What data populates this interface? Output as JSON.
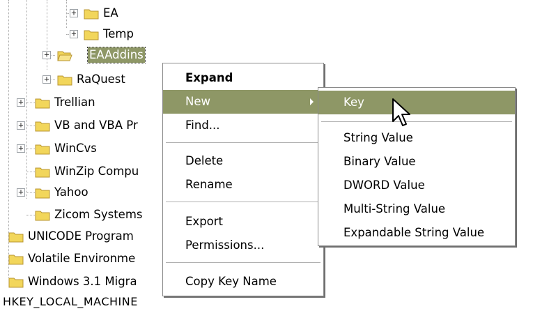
{
  "tree": {
    "items": [
      {
        "label": "EA",
        "expander": "+",
        "icon": "folder-icon"
      },
      {
        "label": "Temp",
        "expander": "+",
        "icon": "folder-icon"
      },
      {
        "label": "EAAddins",
        "expander": "+",
        "icon": "folder-open-icon",
        "selected": true
      },
      {
        "label": "RaQuest",
        "expander": "+",
        "icon": "folder-icon"
      },
      {
        "label": "Trellian",
        "expander": "+",
        "icon": "folder-icon"
      },
      {
        "label": "VB and VBA Pr",
        "expander": "+",
        "icon": "folder-icon"
      },
      {
        "label": "WinCvs",
        "expander": "+",
        "icon": "folder-icon"
      },
      {
        "label": "WinZip Compu",
        "expander": "",
        "icon": "folder-icon"
      },
      {
        "label": "Yahoo",
        "expander": "+",
        "icon": "folder-icon"
      },
      {
        "label": "Zicom Systems",
        "expander": "",
        "icon": "folder-icon"
      },
      {
        "label": "UNICODE Program",
        "expander": "",
        "icon": "folder-icon"
      },
      {
        "label": "Volatile Environme",
        "expander": "",
        "icon": "folder-icon"
      },
      {
        "label": "Windows 3.1 Migra",
        "expander": "",
        "icon": "folder-icon"
      }
    ],
    "root_label": "HKEY_LOCAL_MACHINE"
  },
  "context_menu": {
    "expand": "Expand",
    "new": "New",
    "find": "Find...",
    "delete": "Delete",
    "rename": "Rename",
    "export": "Export",
    "permissions": "Permissions...",
    "copy_key_name": "Copy Key Name"
  },
  "submenu": {
    "key": "Key",
    "string_value": "String Value",
    "binary_value": "Binary Value",
    "dword_value": "DWORD Value",
    "multi_string_value": "Multi-String Value",
    "expandable_string_value": "Expandable String Value"
  },
  "colors": {
    "highlight": "#8e9766",
    "folder_fill": "#f2d65b",
    "folder_edge": "#b89530"
  }
}
